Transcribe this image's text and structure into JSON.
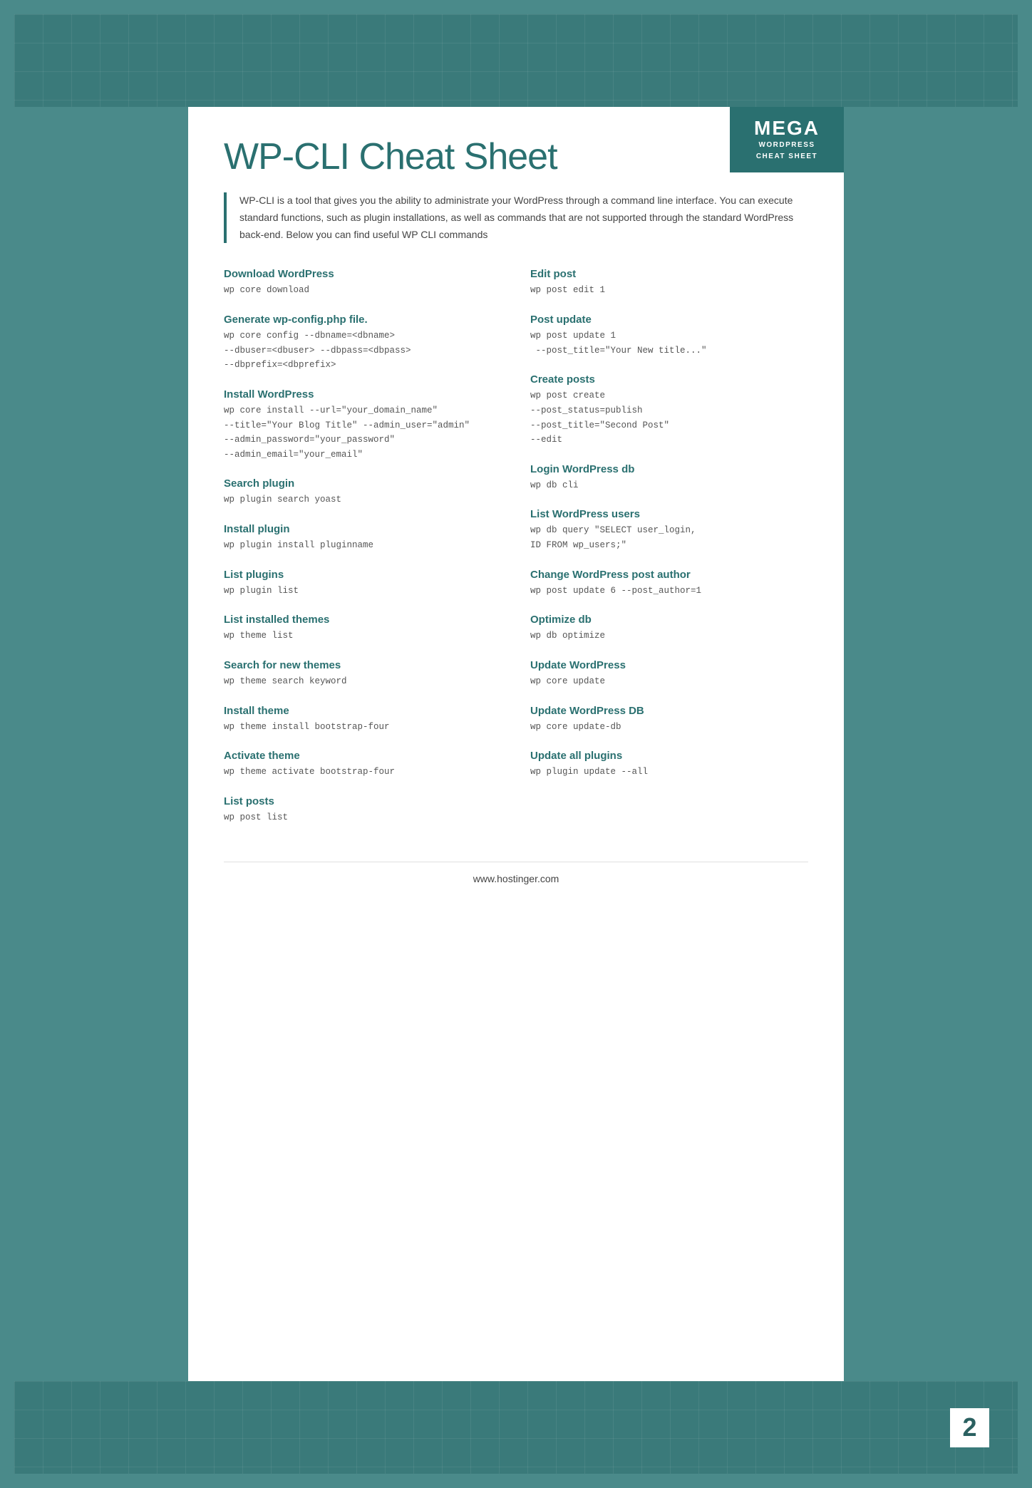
{
  "logo": {
    "mega": "MEGA",
    "line1": "WORDPRESS",
    "line2": "CHEAT SHEET"
  },
  "title": "WP-CLI Cheat Sheet",
  "intro": "WP-CLI is a tool that gives you the ability to administrate your WordPress through a command line interface. You can execute standard functions, such as plugin installations, as well as commands that are not supported through the standard WordPress back-end. Below you can find useful WP CLI commands",
  "left_sections": [
    {
      "title": "Download WordPress",
      "code": "wp core download"
    },
    {
      "title": "Generate wp-config.php file.",
      "code": "wp core config --dbname=<dbname>\n--dbuser=<dbuser> --dbpass=<dbpass>\n--dbprefix=<dbprefix>"
    },
    {
      "title": "Install WordPress",
      "code": "wp core install --url=\"your_domain_name\"\n--title=\"Your Blog Title\" --admin_user=\"admin\"\n--admin_password=\"your_password\"\n--admin_email=\"your_email\""
    },
    {
      "title": "Search plugin",
      "code": "wp plugin search yoast"
    },
    {
      "title": "Install plugin",
      "code": "wp plugin install pluginname"
    },
    {
      "title": "List plugins",
      "code": "wp plugin list"
    },
    {
      "title": "List installed themes",
      "code": "wp theme list"
    },
    {
      "title": "Search for new themes",
      "code": "wp theme search keyword"
    },
    {
      "title": "Install theme",
      "code": "wp theme install bootstrap-four"
    },
    {
      "title": "Activate theme",
      "code": "wp theme activate bootstrap-four"
    },
    {
      "title": "List posts",
      "code": "wp post list"
    }
  ],
  "right_sections": [
    {
      "title": "Edit post",
      "code": "wp post edit 1"
    },
    {
      "title": "Post update",
      "code": "wp post update 1\n --post_title=\"Your New title...\""
    },
    {
      "title": "Create posts",
      "code": "wp post create\n--post_status=publish\n--post_title=\"Second Post\"\n--edit"
    },
    {
      "title": "Login WordPress db",
      "code": "wp db cli"
    },
    {
      "title": "List WordPress users",
      "code": "wp db query \"SELECT user_login,\nID FROM wp_users;\""
    },
    {
      "title": "Change WordPress post author",
      "code": "wp post update 6 --post_author=1"
    },
    {
      "title": "Optimize db",
      "code": "wp db optimize"
    },
    {
      "title": "Update WordPress",
      "code": "wp core update"
    },
    {
      "title": "Update WordPress DB",
      "code": "wp core update-db"
    },
    {
      "title": "Update all plugins",
      "code": "wp plugin update --all"
    }
  ],
  "footer": {
    "url": "www.hostinger.com"
  },
  "page_number": "2"
}
